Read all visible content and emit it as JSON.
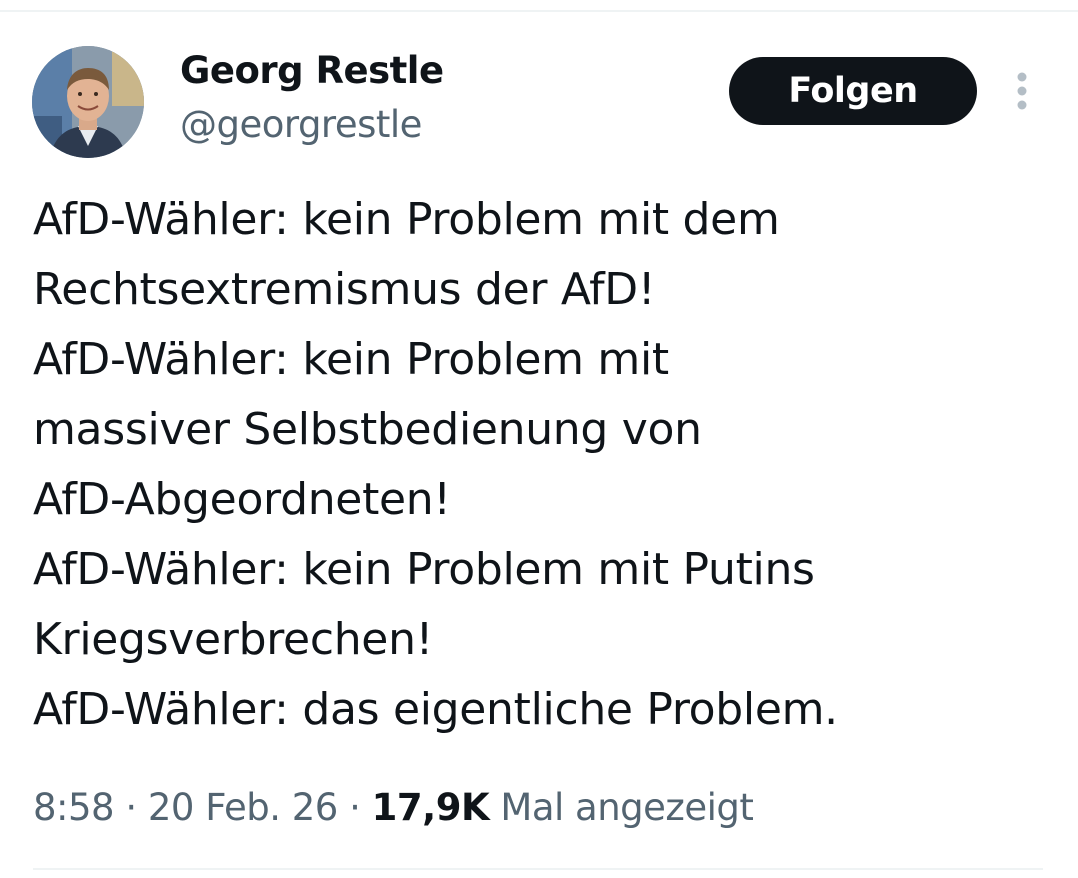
{
  "author": {
    "display_name": "Georg Restle",
    "handle": "@georgrestle",
    "avatar_icon": "profile-photo"
  },
  "follow_button": {
    "label": "Folgen"
  },
  "more_button": {
    "icon": "vertical-ellipsis-icon"
  },
  "tweet": {
    "lines": [
      "AfD-Wähler: kein Problem mit dem",
      "Rechtsextremismus der AfD!",
      "AfD-Wähler: kein Problem mit",
      "massiver Selbstbedienung von",
      "AfD-Abgeordneten!",
      "AfD-Wähler: kein Problem mit Putins",
      "Kriegsverbrechen!",
      "AfD-Wähler: das eigentliche Problem."
    ]
  },
  "meta": {
    "time": "8:58",
    "date": "20 Feb. 26",
    "separator": "·",
    "views_count": "17,9K",
    "views_label": "Mal angezeigt"
  },
  "colors": {
    "text_primary": "#0f1419",
    "text_secondary": "#536471",
    "button_bg": "#0f1419",
    "divider": "#eff3f4"
  }
}
